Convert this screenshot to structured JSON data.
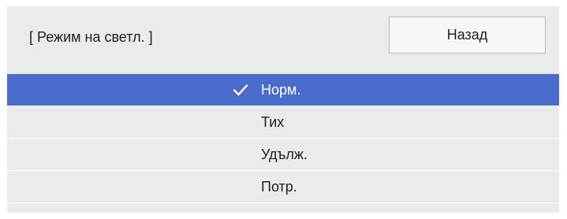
{
  "dialog": {
    "title": "[ Режим на светл. ]",
    "back_label": "Назад"
  },
  "options": [
    {
      "label": "Норм.",
      "selected": true
    },
    {
      "label": "Тих",
      "selected": false
    },
    {
      "label": "Удълж.",
      "selected": false
    },
    {
      "label": "Потр.",
      "selected": false
    }
  ],
  "colors": {
    "selection": "#4a6dcc",
    "panel": "#ebebeb",
    "text": "#1f1f1f"
  },
  "icons": {
    "selected_marker": "checkmark-icon"
  }
}
